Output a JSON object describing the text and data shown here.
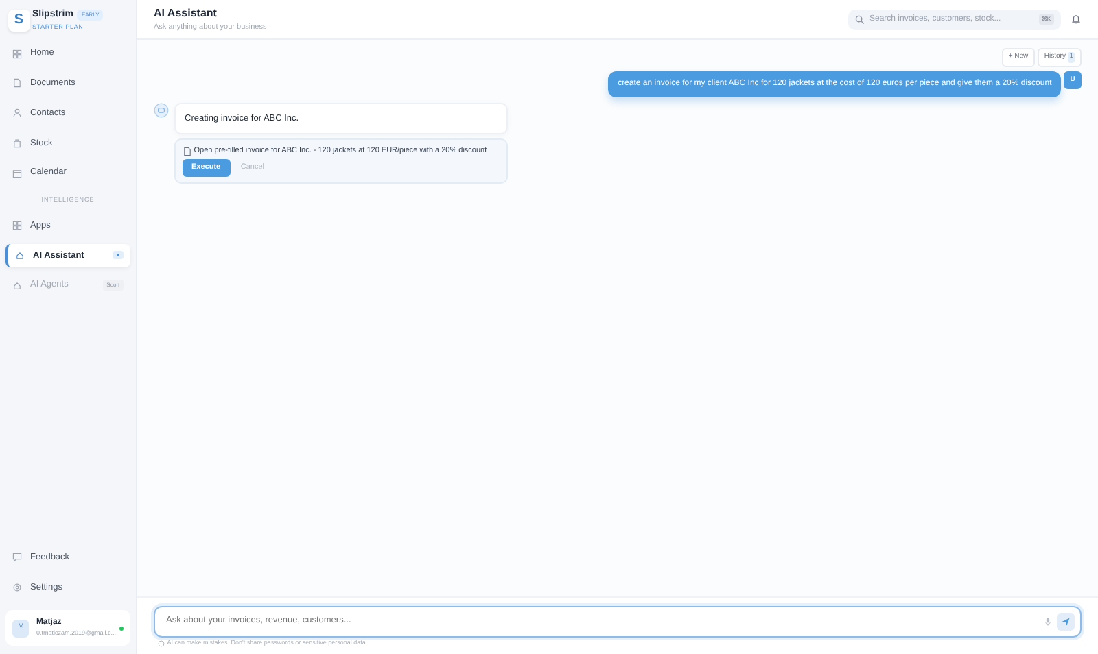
{
  "brand": {
    "logo": "S",
    "name": "Slipstrim",
    "badge": "EARLY",
    "plan": "STARTER PLAN"
  },
  "sidebar": {
    "items": [
      {
        "kind": "nav",
        "label": "Home",
        "selected": false,
        "disabled": false
      },
      {
        "kind": "nav",
        "label": "Documents",
        "selected": false,
        "disabled": false
      },
      {
        "kind": "nav",
        "label": "Contacts",
        "selected": false,
        "disabled": false
      },
      {
        "kind": "nav",
        "label": "Stock",
        "selected": false,
        "disabled": false
      },
      {
        "kind": "nav",
        "label": "Calendar",
        "selected": false,
        "disabled": false
      },
      {
        "kind": "section",
        "label": "INTELLIGENCE"
      },
      {
        "kind": "nav",
        "label": "Apps",
        "selected": false,
        "disabled": false
      },
      {
        "kind": "nav",
        "label": "AI Assistant",
        "selected": true,
        "disabled": false,
        "dot": true
      },
      {
        "kind": "nav",
        "label": "AI Agents",
        "selected": false,
        "disabled": true,
        "badge": "Soon"
      }
    ],
    "bottom": [
      {
        "label": "Feedback"
      },
      {
        "label": "Settings"
      }
    ],
    "user": {
      "initial": "M",
      "name": "Matjaz",
      "email": "0.tmaticzam.2019@gmail.c...",
      "online": true
    }
  },
  "header": {
    "title": "AI Assistant",
    "subtitle": "Ask anything about your business",
    "search_placeholder": "Search invoices, customers, stock...",
    "shortcut": "⌘K"
  },
  "toolbar": {
    "new": "+ New",
    "history": "History",
    "history_count": "1"
  },
  "messages": [
    {
      "kind": "user",
      "avatar": "U",
      "text": "create an invoice for my client ABC Inc for 120 jackets at the cost of 120 euros per piece and give them a 20% discount"
    },
    {
      "kind": "assistant",
      "text": "Creating invoice for ABC Inc.",
      "action": {
        "text": "Open pre-filled invoice for ABC Inc. - 120 jackets at 120 EUR/piece with a 20% discount",
        "execute": "Execute",
        "cancel": "Cancel"
      }
    }
  ],
  "composer": {
    "placeholder": "Ask about your invoices, revenue, customers...",
    "disclaimer": "AI can make mistakes. Don't share passwords or sensitive personal data."
  }
}
